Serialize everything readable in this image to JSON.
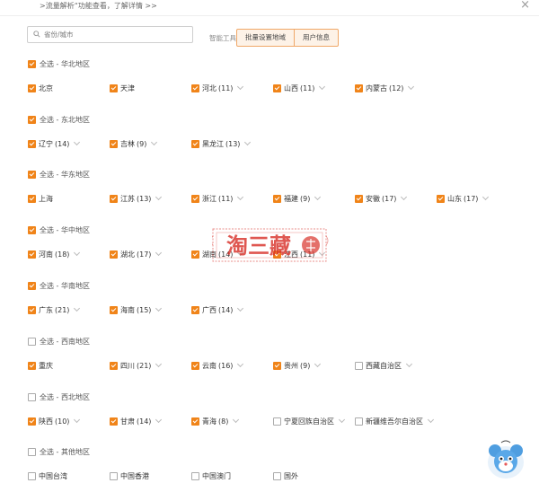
{
  "top_note": ">流量解析“功能查看，了解详情 >>",
  "search": {
    "placeholder": "省份/城市",
    "value": ""
  },
  "tools": {
    "label": "智能工具:",
    "batch_label": "批量设置地域",
    "user_label": "用户信息"
  },
  "colors": {
    "accent": "#f08419",
    "stamp": "#d9332b",
    "tool_border": "#f0a868"
  },
  "stamp": {
    "text": "淘三藏"
  },
  "regions": [
    {
      "label": "全选 - 华北地区",
      "checked": true,
      "provinces": [
        {
          "name": "北京",
          "count": "",
          "checked": true,
          "chevron": false
        },
        {
          "name": "天津",
          "count": "",
          "checked": true,
          "chevron": false
        },
        {
          "name": "河北",
          "count": "(11)",
          "checked": true,
          "chevron": true
        },
        {
          "name": "山西",
          "count": "(11)",
          "checked": true,
          "chevron": true
        },
        {
          "name": "内蒙古",
          "count": "(12)",
          "checked": true,
          "chevron": true
        }
      ]
    },
    {
      "label": "全选 - 东北地区",
      "checked": true,
      "provinces": [
        {
          "name": "辽宁",
          "count": "(14)",
          "checked": true,
          "chevron": true
        },
        {
          "name": "吉林",
          "count": "(9)",
          "checked": true,
          "chevron": true
        },
        {
          "name": "黑龙江",
          "count": "(13)",
          "checked": true,
          "chevron": true
        }
      ]
    },
    {
      "label": "全选 - 华东地区",
      "checked": true,
      "provinces": [
        {
          "name": "上海",
          "count": "",
          "checked": true,
          "chevron": false
        },
        {
          "name": "江苏",
          "count": "(13)",
          "checked": true,
          "chevron": true
        },
        {
          "name": "浙江",
          "count": "(11)",
          "checked": true,
          "chevron": true
        },
        {
          "name": "福建",
          "count": "(9)",
          "checked": true,
          "chevron": true
        },
        {
          "name": "安徽",
          "count": "(17)",
          "checked": true,
          "chevron": true
        },
        {
          "name": "山东",
          "count": "(17)",
          "checked": true,
          "chevron": true
        }
      ]
    },
    {
      "label": "全选 - 华中地区",
      "checked": true,
      "provinces": [
        {
          "name": "河南",
          "count": "(18)",
          "checked": true,
          "chevron": true
        },
        {
          "name": "湖北",
          "count": "(17)",
          "checked": true,
          "chevron": true
        },
        {
          "name": "湖南",
          "count": "(14)",
          "checked": true,
          "chevron": true
        },
        {
          "name": "江西",
          "count": "(11)",
          "checked": true,
          "chevron": true
        }
      ]
    },
    {
      "label": "全选 - 华南地区",
      "checked": true,
      "provinces": [
        {
          "name": "广东",
          "count": "(21)",
          "checked": true,
          "chevron": true
        },
        {
          "name": "海南",
          "count": "(15)",
          "checked": true,
          "chevron": true
        },
        {
          "name": "广西",
          "count": "(14)",
          "checked": true,
          "chevron": true
        }
      ]
    },
    {
      "label": "全选 - 西南地区",
      "checked": false,
      "provinces": [
        {
          "name": "重庆",
          "count": "",
          "checked": true,
          "chevron": false
        },
        {
          "name": "四川",
          "count": "(21)",
          "checked": true,
          "chevron": true
        },
        {
          "name": "云南",
          "count": "(16)",
          "checked": true,
          "chevron": true
        },
        {
          "name": "贵州",
          "count": "(9)",
          "checked": true,
          "chevron": true
        },
        {
          "name": "西藏自治区",
          "count": "",
          "checked": false,
          "chevron": true
        }
      ]
    },
    {
      "label": "全选 - 西北地区",
      "checked": false,
      "provinces": [
        {
          "name": "陕西",
          "count": "(10)",
          "checked": true,
          "chevron": true
        },
        {
          "name": "甘肃",
          "count": "(14)",
          "checked": true,
          "chevron": true
        },
        {
          "name": "青海",
          "count": "(8)",
          "checked": true,
          "chevron": true
        },
        {
          "name": "宁夏回族自治区",
          "count": "",
          "checked": false,
          "chevron": true
        },
        {
          "name": "新疆维吾尔自治区",
          "count": "",
          "checked": false,
          "chevron": true
        }
      ]
    },
    {
      "label": "全选 - 其他地区",
      "checked": false,
      "provinces": [
        {
          "name": "中国台湾",
          "count": "",
          "checked": false,
          "chevron": false
        },
        {
          "name": "中国香港",
          "count": "",
          "checked": false,
          "chevron": false
        },
        {
          "name": "中国澳门",
          "count": "",
          "checked": false,
          "chevron": false
        },
        {
          "name": "国外",
          "count": "",
          "checked": false,
          "chevron": false
        }
      ]
    }
  ]
}
